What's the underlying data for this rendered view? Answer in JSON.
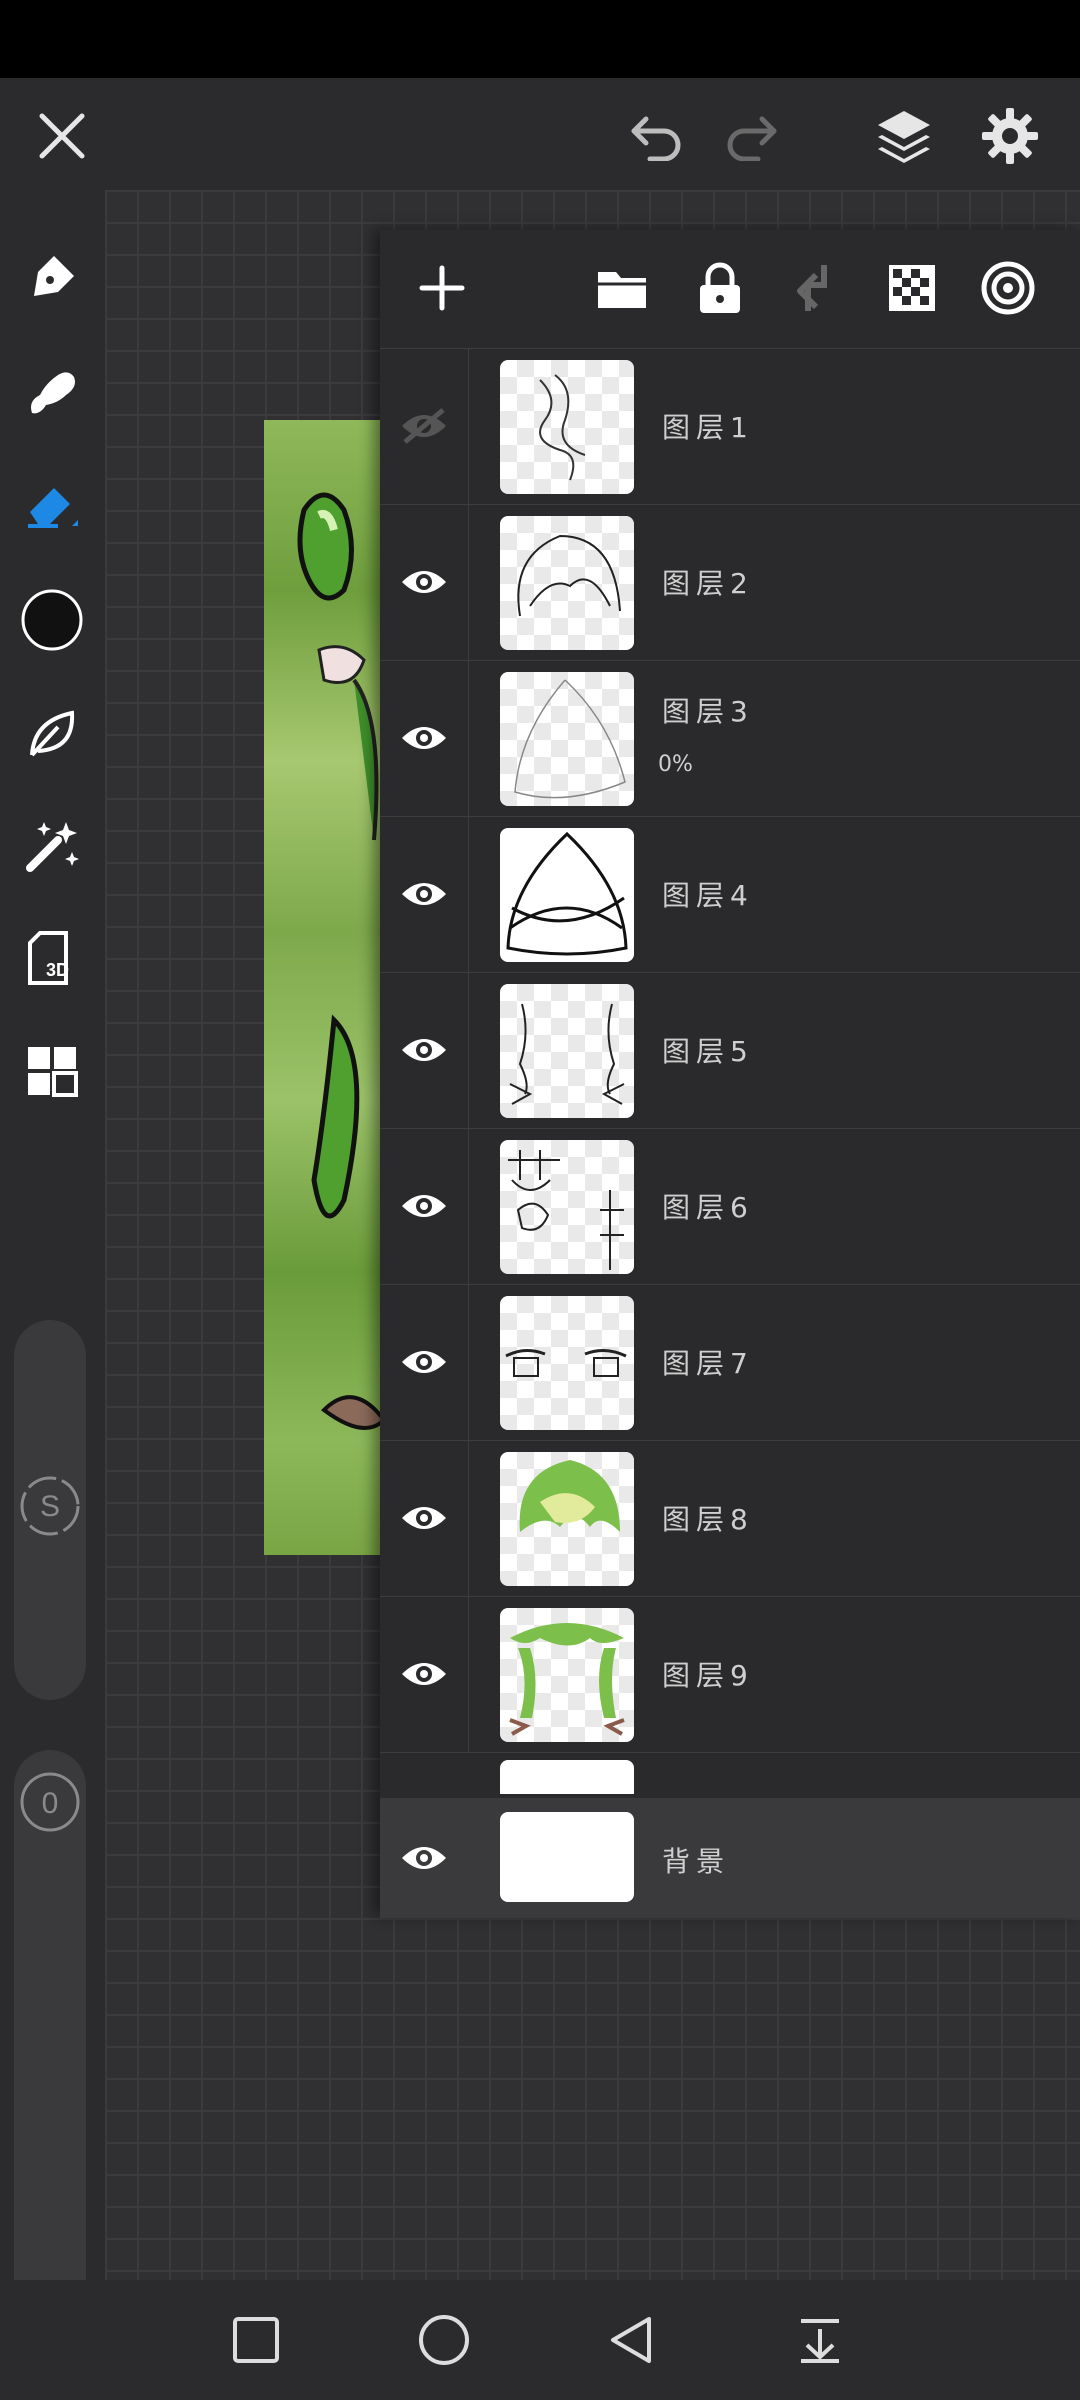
{
  "colors": {
    "accent": "#1e88e5",
    "panel": "#2a2a2c",
    "toolbar": "#2b2b2d"
  },
  "topbar": {
    "icons": [
      "close-icon",
      "undo-icon",
      "redo-icon",
      "layers-icon",
      "settings-icon"
    ]
  },
  "left_tools": {
    "icons": [
      "pen-icon",
      "smudge-icon",
      "eraser-icon",
      "color-icon",
      "leaf-brush-icon",
      "magic-wand-icon",
      "3d-icon",
      "gallery-icon"
    ],
    "model_3d_label": "3D",
    "size_label": "S",
    "opacity_value": "0"
  },
  "layer_panel": {
    "toolbar_icons": [
      "add-icon",
      "folder-icon",
      "lock-icon",
      "merge-down-icon",
      "alpha-lock-icon",
      "clipping-icon"
    ],
    "layers": [
      {
        "name": "图层1",
        "visible": false
      },
      {
        "name": "图层2",
        "visible": true
      },
      {
        "name": "图层3",
        "visible": true,
        "opacity": "0%"
      },
      {
        "name": "图层4",
        "visible": true
      },
      {
        "name": "图层5",
        "visible": true
      },
      {
        "name": "图层6",
        "visible": true
      },
      {
        "name": "图层7",
        "visible": true
      },
      {
        "name": "图层8",
        "visible": true
      },
      {
        "name": "图层9",
        "visible": true
      }
    ],
    "background_layer": {
      "name": "背景",
      "visible": true
    }
  },
  "navbar": {
    "icons": [
      "recents-icon",
      "home-icon",
      "back-icon",
      "notification-pull-icon"
    ]
  }
}
